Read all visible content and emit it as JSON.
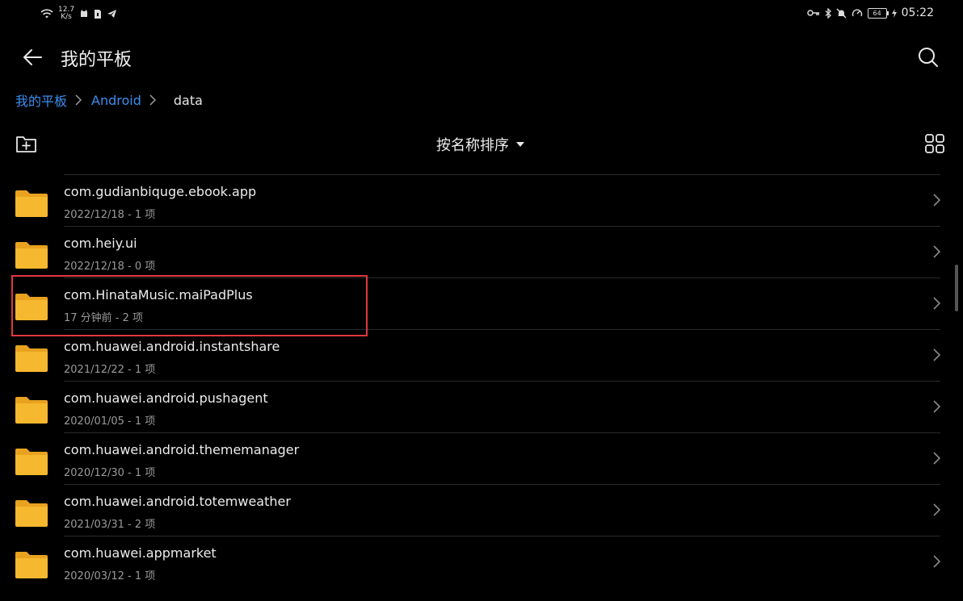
{
  "status_bar": {
    "net_speed_value": "12.7",
    "net_speed_unit": "K/s",
    "battery": "64",
    "time": "05:22"
  },
  "header": {
    "title": "我的平板"
  },
  "breadcrumb": {
    "items": [
      "我的平板",
      "Android",
      "data"
    ]
  },
  "toolbar": {
    "sort_label": "按名称排序"
  },
  "files": [
    {
      "name": "com.gudianbiquge.ebook.app",
      "meta": "2022/12/18 - 1 项"
    },
    {
      "name": "com.heiy.ui",
      "meta": "2022/12/18 - 0 项"
    },
    {
      "name": "com.HinataMusic.maiPadPlus",
      "meta": "17 分钟前 - 2 项"
    },
    {
      "name": "com.huawei.android.instantshare",
      "meta": "2021/12/22 - 1 项"
    },
    {
      "name": "com.huawei.android.pushagent",
      "meta": "2020/01/05 - 1 项"
    },
    {
      "name": "com.huawei.android.thememanager",
      "meta": "2020/12/30 - 1 项"
    },
    {
      "name": "com.huawei.android.totemweather",
      "meta": "2021/03/31 - 2 项"
    },
    {
      "name": "com.huawei.appmarket",
      "meta": "2020/03/12 - 1 项"
    }
  ],
  "colors": {
    "accent": "#3b8ef0",
    "folder": "#f5b82e",
    "highlight_box": "#e0383e"
  },
  "icons": [
    "wifi-icon",
    "bell-off-icon",
    "key-icon",
    "bluetooth-icon",
    "speedometer-icon",
    "search-icon",
    "back-arrow-icon",
    "new-folder-icon",
    "grid-view-icon",
    "folder-icon",
    "chevron-right-icon"
  ]
}
